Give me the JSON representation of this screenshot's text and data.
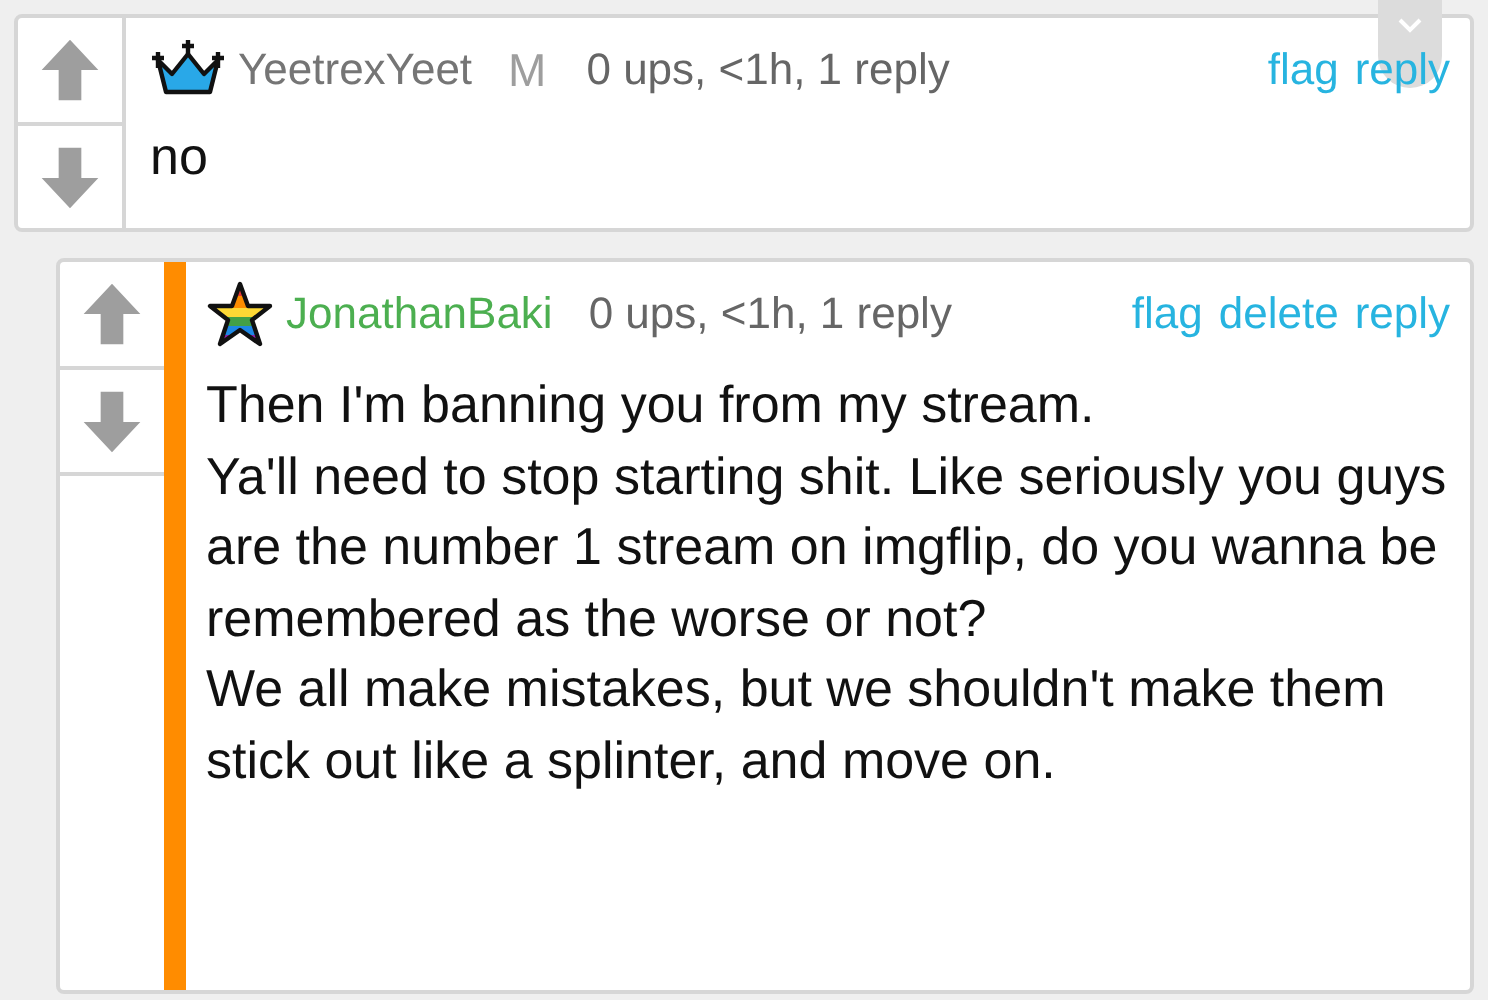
{
  "comments": [
    {
      "kind": "crown",
      "user": "YeetrexYeet",
      "color": "#757575",
      "badge": "M",
      "stats": "0 ups, <1h, 1 reply",
      "actions": [
        "flag",
        "reply"
      ],
      "body": "no",
      "children": [
        {
          "kind": "rainbow-star",
          "user": "JonathanBaki",
          "color": "#4caf50",
          "stats": "0 ups, <1h, 1 reply",
          "actions": [
            "flag",
            "delete",
            "reply"
          ],
          "body": "Then I'm banning you from my stream.\nYa'll need to stop starting shit. Like seriously you guys are the number 1 stream on imgflip, do you wanna be remembered as the worse or not?\nWe all make mistakes, but we shouldn't make them stick out like a splinter, and move on."
        }
      ]
    }
  ]
}
